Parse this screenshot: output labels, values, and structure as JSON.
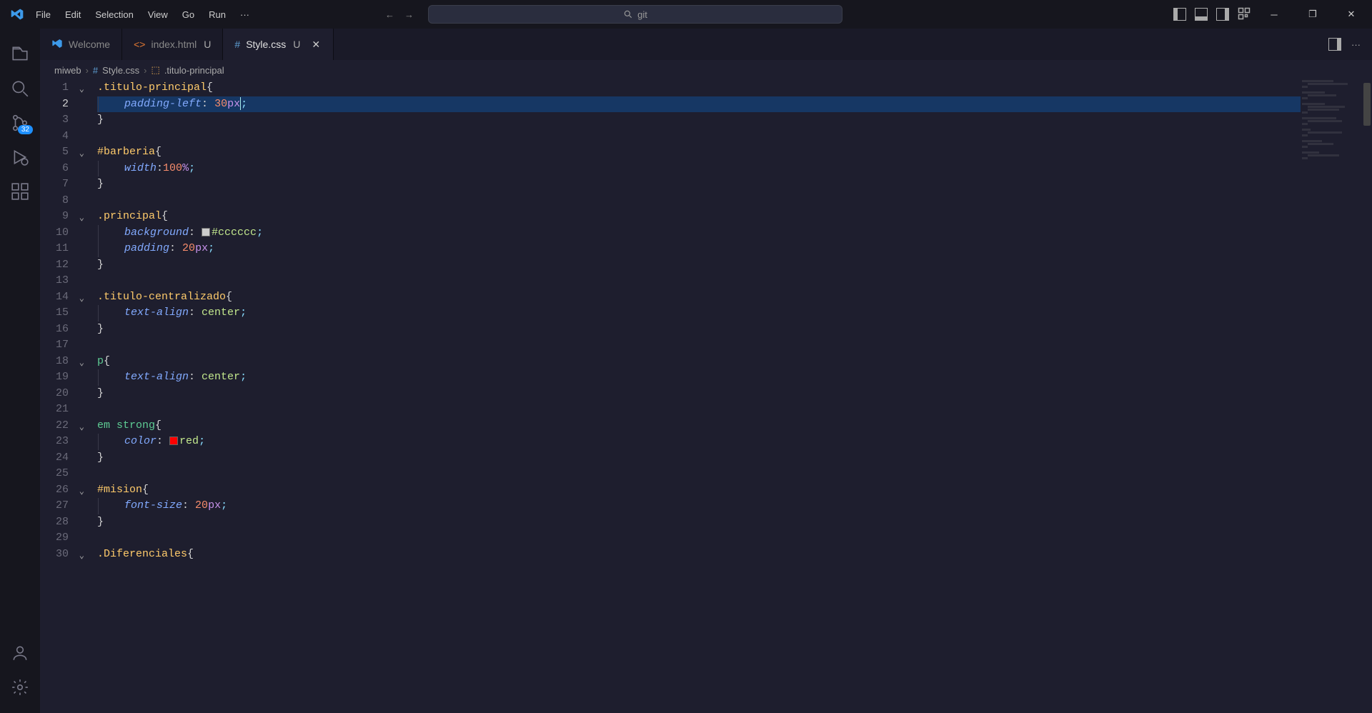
{
  "menu": {
    "file": "File",
    "edit": "Edit",
    "selection": "Selection",
    "view": "View",
    "go": "Go",
    "run": "Run",
    "more": "···"
  },
  "search": {
    "placeholder": "git"
  },
  "activity": {
    "scm_badge": "32"
  },
  "tabs": {
    "welcome": "Welcome",
    "index": "index.html",
    "index_mod": "U",
    "style": "Style.css",
    "style_mod": "U"
  },
  "breadcrumb": {
    "folder": "miweb",
    "file": "Style.css",
    "symbol": ".titulo-principal"
  },
  "code": {
    "lines": [
      {
        "n": 1,
        "fold": true,
        "tokens": [
          {
            "t": ".titulo-principal",
            "c": "tk-sel-class"
          },
          {
            "t": "{",
            "c": "tk-punc"
          }
        ]
      },
      {
        "n": 2,
        "fold": false,
        "hl": true,
        "indent": 1,
        "tokens": [
          {
            "t": "padding-left",
            "c": "tk-prop"
          },
          {
            "t": ": ",
            "c": "tk-colon"
          },
          {
            "t": "30",
            "c": "tk-num"
          },
          {
            "t": "px",
            "c": "tk-unit"
          },
          {
            "t": ";",
            "c": "tk-semi"
          }
        ],
        "cursor_after": 3
      },
      {
        "n": 3,
        "fold": false,
        "tokens": [
          {
            "t": "}",
            "c": "tk-punc"
          }
        ]
      },
      {
        "n": 4,
        "fold": false,
        "tokens": []
      },
      {
        "n": 5,
        "fold": true,
        "tokens": [
          {
            "t": "#barberia",
            "c": "tk-sel-id"
          },
          {
            "t": "{",
            "c": "tk-punc"
          }
        ]
      },
      {
        "n": 6,
        "fold": false,
        "indent": 1,
        "tokens": [
          {
            "t": "width",
            "c": "tk-prop"
          },
          {
            "t": ":",
            "c": "tk-colon"
          },
          {
            "t": "100",
            "c": "tk-num"
          },
          {
            "t": "%",
            "c": "tk-unit"
          },
          {
            "t": ";",
            "c": "tk-semi"
          }
        ]
      },
      {
        "n": 7,
        "fold": false,
        "tokens": [
          {
            "t": "}",
            "c": "tk-punc"
          }
        ]
      },
      {
        "n": 8,
        "fold": false,
        "tokens": []
      },
      {
        "n": 9,
        "fold": true,
        "tokens": [
          {
            "t": ".principal",
            "c": "tk-sel-class"
          },
          {
            "t": "{",
            "c": "tk-punc"
          }
        ]
      },
      {
        "n": 10,
        "fold": false,
        "indent": 1,
        "tokens": [
          {
            "t": "background",
            "c": "tk-prop"
          },
          {
            "t": ": ",
            "c": "tk-colon"
          },
          {
            "swatch": "#cccccc"
          },
          {
            "t": "#cccccc",
            "c": "tk-hex"
          },
          {
            "t": ";",
            "c": "tk-semi"
          }
        ]
      },
      {
        "n": 11,
        "fold": false,
        "indent": 1,
        "tokens": [
          {
            "t": "padding",
            "c": "tk-prop"
          },
          {
            "t": ": ",
            "c": "tk-colon"
          },
          {
            "t": "20",
            "c": "tk-num"
          },
          {
            "t": "px",
            "c": "tk-unit"
          },
          {
            "t": ";",
            "c": "tk-semi"
          }
        ]
      },
      {
        "n": 12,
        "fold": false,
        "tokens": [
          {
            "t": "}",
            "c": "tk-punc"
          }
        ]
      },
      {
        "n": 13,
        "fold": false,
        "tokens": []
      },
      {
        "n": 14,
        "fold": true,
        "tokens": [
          {
            "t": ".titulo-centralizado",
            "c": "tk-sel-class"
          },
          {
            "t": "{",
            "c": "tk-punc"
          }
        ]
      },
      {
        "n": 15,
        "fold": false,
        "indent": 1,
        "tokens": [
          {
            "t": "text-align",
            "c": "tk-prop"
          },
          {
            "t": ": ",
            "c": "tk-colon"
          },
          {
            "t": "center",
            "c": "tk-kw"
          },
          {
            "t": ";",
            "c": "tk-semi"
          }
        ]
      },
      {
        "n": 16,
        "fold": false,
        "tokens": [
          {
            "t": "}",
            "c": "tk-punc"
          }
        ]
      },
      {
        "n": 17,
        "fold": false,
        "tokens": []
      },
      {
        "n": 18,
        "fold": true,
        "tokens": [
          {
            "t": "p",
            "c": "tk-sel-tag"
          },
          {
            "t": "{",
            "c": "tk-punc"
          }
        ]
      },
      {
        "n": 19,
        "fold": false,
        "indent": 1,
        "tokens": [
          {
            "t": "text-align",
            "c": "tk-prop"
          },
          {
            "t": ": ",
            "c": "tk-colon"
          },
          {
            "t": "center",
            "c": "tk-kw"
          },
          {
            "t": ";",
            "c": "tk-semi"
          }
        ]
      },
      {
        "n": 20,
        "fold": false,
        "tokens": [
          {
            "t": "}",
            "c": "tk-punc"
          }
        ]
      },
      {
        "n": 21,
        "fold": false,
        "tokens": []
      },
      {
        "n": 22,
        "fold": true,
        "tokens": [
          {
            "t": "em ",
            "c": "tk-sel-tag"
          },
          {
            "t": "strong",
            "c": "tk-sel-tag"
          },
          {
            "t": "{",
            "c": "tk-punc"
          }
        ]
      },
      {
        "n": 23,
        "fold": false,
        "indent": 1,
        "tokens": [
          {
            "t": "color",
            "c": "tk-prop"
          },
          {
            "t": ": ",
            "c": "tk-colon"
          },
          {
            "swatch": "#ff0000"
          },
          {
            "t": "red",
            "c": "tk-kw"
          },
          {
            "t": ";",
            "c": "tk-semi"
          }
        ]
      },
      {
        "n": 24,
        "fold": false,
        "tokens": [
          {
            "t": "}",
            "c": "tk-punc"
          }
        ]
      },
      {
        "n": 25,
        "fold": false,
        "tokens": []
      },
      {
        "n": 26,
        "fold": true,
        "tokens": [
          {
            "t": "#mision",
            "c": "tk-sel-id"
          },
          {
            "t": "{",
            "c": "tk-punc"
          }
        ]
      },
      {
        "n": 27,
        "fold": false,
        "indent": 1,
        "tokens": [
          {
            "t": "font-size",
            "c": "tk-prop"
          },
          {
            "t": ": ",
            "c": "tk-colon"
          },
          {
            "t": "20",
            "c": "tk-num"
          },
          {
            "t": "px",
            "c": "tk-unit"
          },
          {
            "t": ";",
            "c": "tk-semi"
          }
        ]
      },
      {
        "n": 28,
        "fold": false,
        "tokens": [
          {
            "t": "}",
            "c": "tk-punc"
          }
        ]
      },
      {
        "n": 29,
        "fold": false,
        "tokens": []
      },
      {
        "n": 30,
        "fold": true,
        "tokens": [
          {
            "t": ".Diferenciales",
            "c": "tk-sel-class"
          },
          {
            "t": "{",
            "c": "tk-punc"
          }
        ]
      }
    ]
  }
}
